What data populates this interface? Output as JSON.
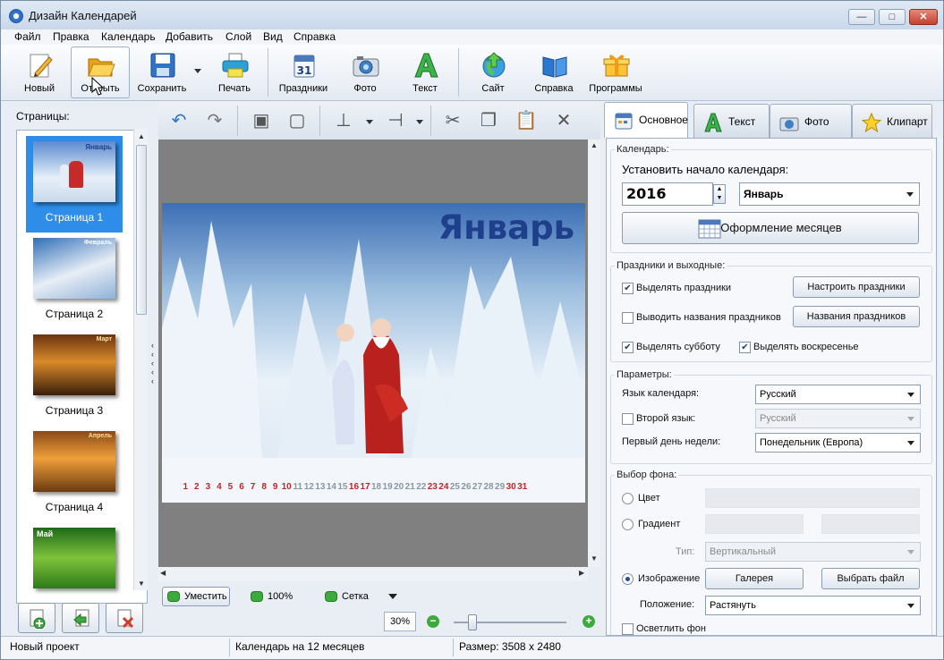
{
  "window": {
    "title": "Дизайн Календарей",
    "controls": [
      "—",
      "□",
      "✕"
    ]
  },
  "menu": [
    "Файл",
    "Правка",
    "Календарь",
    "Добавить",
    "Слой",
    "Вид",
    "Справка"
  ],
  "toolbar": {
    "new": "Новый",
    "open": "Открыть",
    "save": "Сохранить",
    "print": "Печать",
    "holidays": "Праздники",
    "photo": "Фото",
    "text": "Текст",
    "site": "Сайт",
    "help": "Справка",
    "programs": "Программы"
  },
  "pages_panel": {
    "label": "Страницы:",
    "pages": [
      {
        "caption": "Страница 1",
        "thumb_title": "Январь",
        "selected": true
      },
      {
        "caption": "Страница 2",
        "thumb_title": "Февраль",
        "selected": false
      },
      {
        "caption": "Страница 3",
        "thumb_title": "Март",
        "selected": false
      },
      {
        "caption": "Страница 4",
        "thumb_title": "Апрель",
        "selected": false
      },
      {
        "caption": "",
        "thumb_title": "Май",
        "selected": false
      }
    ]
  },
  "canvas": {
    "month_title": "Январь",
    "day_numbers": [
      "1",
      "2",
      "3",
      "4",
      "5",
      "6",
      "7",
      "8",
      "9",
      "10",
      "11",
      "12",
      "13",
      "14",
      "15",
      "16",
      "17",
      "18",
      "19",
      "20",
      "21",
      "22",
      "23",
      "24",
      "25",
      "26",
      "27",
      "28",
      "29",
      "30",
      "31"
    ],
    "holiday_days": [
      1,
      2,
      3,
      4,
      5,
      6,
      7,
      8,
      9,
      10,
      16,
      17,
      23,
      24,
      30,
      31
    ]
  },
  "zoom_bar": {
    "fit": "Уместить",
    "hundred": "100%",
    "grid": "Сетка",
    "zoom_value": "30%"
  },
  "tabs": [
    {
      "label": "Основное",
      "active": true
    },
    {
      "label": "Текст",
      "active": false
    },
    {
      "label": "Фото",
      "active": false
    },
    {
      "label": "Клипарт",
      "active": false
    }
  ],
  "calendar_group": {
    "title": "Календарь:",
    "start_label": "Установить начало календаря:",
    "year": "2016",
    "month": "Январь",
    "months_design_button": "Оформление месяцев"
  },
  "holidays_group": {
    "title": "Праздники и выходные:",
    "highlight_holidays": {
      "label": "Выделять праздники",
      "checked": true
    },
    "configure_button": "Настроить праздники",
    "show_names": {
      "label": "Выводить названия праздников",
      "checked": false
    },
    "names_button": "Названия праздников",
    "highlight_saturday": {
      "label": "Выделять субботу",
      "checked": true
    },
    "highlight_sunday": {
      "label": "Выделять воскресенье",
      "checked": true
    }
  },
  "params_group": {
    "title": "Параметры:",
    "language_label": "Язык календаря:",
    "language_value": "Русский",
    "second_language": {
      "label": "Второй язык:",
      "checked": false
    },
    "second_language_value": "Русский",
    "first_day_label": "Первый день недели:",
    "first_day_value": "Понедельник (Европа)"
  },
  "background_group": {
    "title": "Выбор фона:",
    "color_label": "Цвет",
    "gradient_label": "Градиент",
    "type_label": "Тип:",
    "type_value": "Вертикальный",
    "image_label": "Изображение",
    "gallery_button": "Галерея",
    "choose_file_button": "Выбрать файл",
    "position_label": "Положение:",
    "position_value": "Растянуть",
    "lighten_label": "Осветлить фон",
    "selected": "image"
  },
  "status": {
    "project": "Новый проект",
    "calendar": "Календарь на 12 месяцев",
    "size": "Размер: 3508 x 2480"
  }
}
